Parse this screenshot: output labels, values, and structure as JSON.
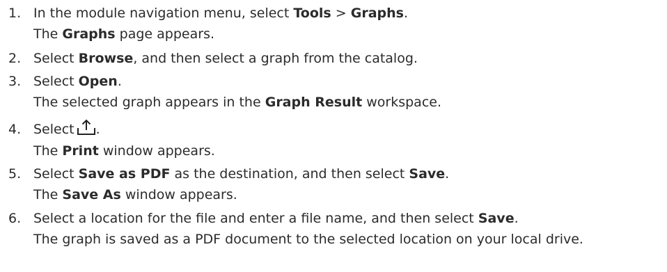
{
  "steps": [
    {
      "number": "1.",
      "parts": [
        "In the module navigation menu, select ",
        "Tools",
        " > ",
        "Graphs",
        "."
      ],
      "result": [
        "The ",
        "Graphs",
        " page appears."
      ]
    },
    {
      "number": "2.",
      "parts": [
        "Select ",
        "Browse",
        ", and then select a graph from the catalog."
      ]
    },
    {
      "number": "3.",
      "parts": [
        "Select ",
        "Open",
        "."
      ],
      "result": [
        "The selected graph appears in the ",
        "Graph Result",
        " workspace."
      ]
    },
    {
      "number": "4.",
      "parts": [
        "Select",
        "."
      ],
      "icon": "share-upload-icon",
      "result": [
        "The ",
        "Print",
        " window appears."
      ]
    },
    {
      "number": "5.",
      "parts": [
        "Select ",
        "Save as PDF",
        " as the destination, and then select ",
        "Save",
        "."
      ],
      "result": [
        "The ",
        "Save As",
        " window appears."
      ]
    },
    {
      "number": "6.",
      "parts": [
        "Select a location for the file and enter a file name, and then select ",
        "Save",
        "."
      ],
      "result": [
        "The graph is saved as a PDF document to the selected location on your local drive."
      ]
    }
  ]
}
